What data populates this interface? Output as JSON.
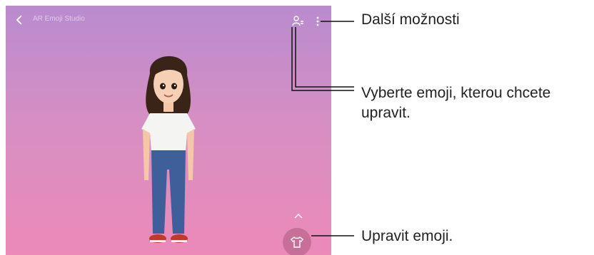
{
  "app": {
    "title": "AR Emoji Studio",
    "back_icon": "chevron-left-icon"
  },
  "toolbar": {
    "select_emoji_icon": "person-switch-icon",
    "more_options_icon": "more-vertical-icon"
  },
  "controls": {
    "expand_icon": "chevron-up-icon",
    "outfit_icon": "tshirt-icon"
  },
  "callouts": {
    "more_options": "Další možnosti",
    "select_emoji": "Vyberte emoji, kterou chcete upravit.",
    "edit_emoji": "Upravit emoji."
  },
  "colors": {
    "background_top": "#b98bcf",
    "background_bottom": "#ec8ab9",
    "outfit_button": "#c76f98",
    "callout_line": "#111111"
  }
}
